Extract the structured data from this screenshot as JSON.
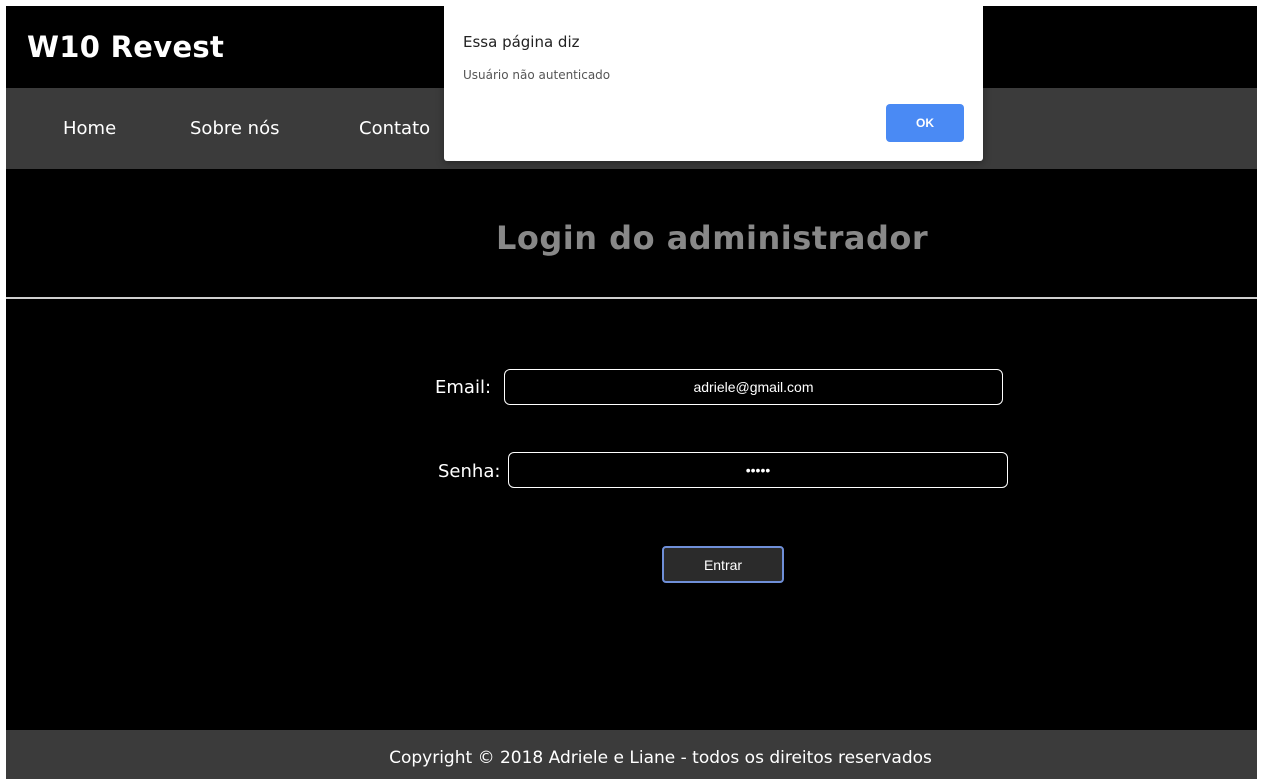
{
  "header": {
    "brand": "W10 Revest"
  },
  "nav": {
    "items": [
      {
        "label": "Home"
      },
      {
        "label": "Sobre nós"
      },
      {
        "label": "Contato"
      }
    ]
  },
  "hero": {
    "title": "Login do administrador"
  },
  "form": {
    "email_label": "Email:",
    "email_value": "adriele@gmail.com",
    "password_label": "Senha:",
    "password_value": "•••••",
    "submit_label": "Entrar"
  },
  "footer": {
    "text": "Copyright © 2018 Adriele e Liane - todos os direitos reservados"
  },
  "alert": {
    "title": "Essa página diz",
    "message": "Usuário não autenticado",
    "ok_label": "OK"
  },
  "colors": {
    "page_bg": "#000000",
    "bar_bg": "#3b3b3b",
    "hero_title": "#888888",
    "ok_button": "#4a8af4",
    "submit_border": "#6f8fd8"
  }
}
